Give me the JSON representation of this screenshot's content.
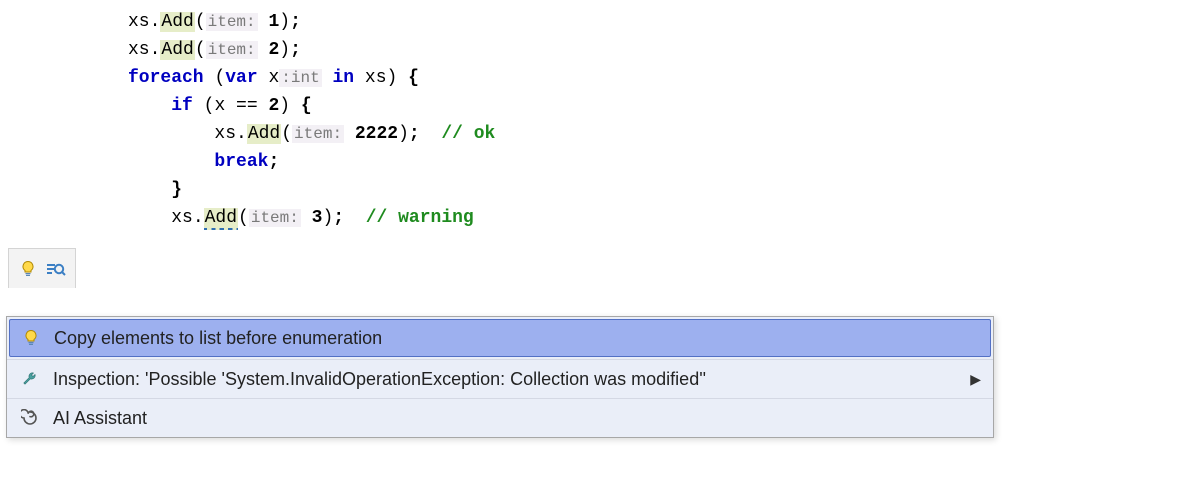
{
  "code": {
    "lines": [
      {
        "indent": "",
        "tokens": [
          {
            "t": "ident",
            "v": "xs."
          },
          {
            "t": "method",
            "v": "Add"
          },
          {
            "t": "paren",
            "v": "("
          },
          {
            "t": "hint",
            "v": "item:"
          },
          {
            "t": "ident",
            "v": " "
          },
          {
            "t": "numlit",
            "v": "1"
          },
          {
            "t": "paren",
            "v": ")"
          },
          {
            "t": "semi",
            "v": ";"
          }
        ]
      },
      {
        "indent": "",
        "tokens": [
          {
            "t": "ident",
            "v": "xs."
          },
          {
            "t": "method",
            "v": "Add"
          },
          {
            "t": "paren",
            "v": "("
          },
          {
            "t": "hint",
            "v": "item:"
          },
          {
            "t": "ident",
            "v": " "
          },
          {
            "t": "numlit",
            "v": "2"
          },
          {
            "t": "paren",
            "v": ")"
          },
          {
            "t": "semi",
            "v": ";"
          }
        ]
      },
      {
        "indent": "",
        "tokens": [
          {
            "t": "k-foreach",
            "v": "foreach"
          },
          {
            "t": "ident",
            "v": " "
          },
          {
            "t": "paren",
            "v": "("
          },
          {
            "t": "k-var",
            "v": "var"
          },
          {
            "t": "ident",
            "v": " x"
          },
          {
            "t": "hint",
            "v": ":int"
          },
          {
            "t": "ident",
            "v": " "
          },
          {
            "t": "k-in",
            "v": "in"
          },
          {
            "t": "ident",
            "v": " xs"
          },
          {
            "t": "paren",
            "v": ")"
          },
          {
            "t": "ident",
            "v": " "
          },
          {
            "t": "brace",
            "v": "{"
          }
        ]
      },
      {
        "indent": "    ",
        "tokens": [
          {
            "t": "k-if",
            "v": "if"
          },
          {
            "t": "ident",
            "v": " "
          },
          {
            "t": "paren",
            "v": "("
          },
          {
            "t": "ident",
            "v": "x == "
          },
          {
            "t": "numlit",
            "v": "2"
          },
          {
            "t": "paren",
            "v": ")"
          },
          {
            "t": "ident",
            "v": " "
          },
          {
            "t": "brace",
            "v": "{"
          }
        ]
      },
      {
        "indent": "        ",
        "tokens": [
          {
            "t": "ident",
            "v": "xs."
          },
          {
            "t": "method",
            "v": "Add"
          },
          {
            "t": "paren",
            "v": "("
          },
          {
            "t": "hint",
            "v": "item:"
          },
          {
            "t": "ident",
            "v": " "
          },
          {
            "t": "numlit",
            "v": "2222"
          },
          {
            "t": "paren",
            "v": ")"
          },
          {
            "t": "semi",
            "v": ";"
          },
          {
            "t": "ident",
            "v": "  "
          },
          {
            "t": "comment",
            "v": "// ok"
          }
        ]
      },
      {
        "indent": "        ",
        "tokens": [
          {
            "t": "k-break",
            "v": "break"
          },
          {
            "t": "semi",
            "v": ";"
          }
        ]
      },
      {
        "indent": "    ",
        "tokens": [
          {
            "t": "brace",
            "v": "}"
          }
        ]
      },
      {
        "indent": "    ",
        "tokens": [
          {
            "t": "ident",
            "v": "xs."
          },
          {
            "t": "method-warn",
            "v": "Add"
          },
          {
            "t": "paren",
            "v": "("
          },
          {
            "t": "hint",
            "v": "item:"
          },
          {
            "t": "ident",
            "v": " "
          },
          {
            "t": "numlit",
            "v": "3"
          },
          {
            "t": "paren",
            "v": ")"
          },
          {
            "t": "semi",
            "v": ";"
          },
          {
            "t": "ident",
            "v": "  "
          },
          {
            "t": "comment",
            "v": "// warning"
          }
        ]
      }
    ]
  },
  "popup": {
    "items": [
      {
        "icon": "bulb-icon",
        "label": "Copy elements to list before enumeration",
        "selected": true,
        "submenu": false
      },
      {
        "icon": "wrench-icon",
        "label": "Inspection: 'Possible 'System.InvalidOperationException: Collection was modified''",
        "selected": false,
        "submenu": true
      },
      {
        "icon": "spiral-icon",
        "label": "AI Assistant",
        "selected": false,
        "submenu": false
      }
    ]
  },
  "gutter": {
    "icons": [
      "bulb-icon",
      "find-action-icon"
    ]
  },
  "colors": {
    "keyword": "#0000c0",
    "comment": "#1f8b1f",
    "hint_bg": "#f3f0f5",
    "method_bg": "#e6edc8",
    "popup_bg": "#eaeef8",
    "popup_selected": "#9db0ef"
  }
}
